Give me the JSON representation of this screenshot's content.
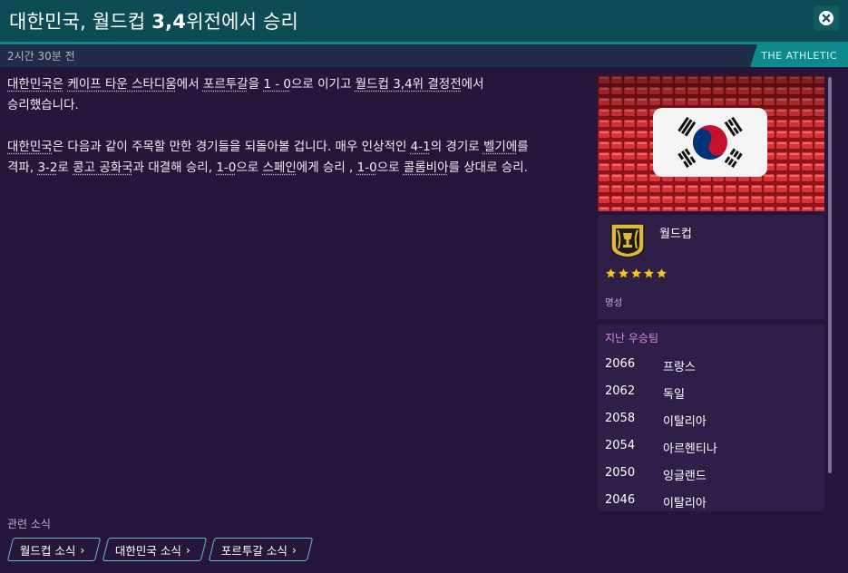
{
  "header": {
    "title_prefix": "대한민국, 월드컵 ",
    "title_bold": "3,4",
    "title_suffix": "위전에서 승리",
    "close_icon": "close-circle-icon"
  },
  "meta": {
    "time_ago": "2시간 30분 전",
    "source": "THE ATHLETIC"
  },
  "article": {
    "p1": {
      "t1": "대한민국은",
      "t2": " ",
      "t3": "케이프 타운 스타디움",
      "t4": "에서 ",
      "t5": "포르투갈",
      "t6": "을 ",
      "t7": "1 - 0",
      "t8": "으로 이기고 ",
      "t9": "월드컵 3,4위 결정전",
      "t10": "에서",
      "t11": "승리했습니다."
    },
    "p2": {
      "t1": "대한민국",
      "t2": "은 다음과 같이 주목할 만한 경기들을 되돌아볼 겁니다. 매우 인상적인 ",
      "t3": "4-1",
      "t4": "의 경기로 ",
      "t5": "벨기에",
      "t6": "를",
      "t7": "격파, ",
      "t8": "3-2",
      "t9": "로 ",
      "t10": "콩고 공화국",
      "t11": "과 대결해 승리, ",
      "t12": "1-0",
      "t13": "으로 ",
      "t14": "스페인",
      "t15": "에게 승리 , ",
      "t16": "1-0",
      "t17": "으로 ",
      "t18": "콜롬비아",
      "t19": "를 상대로 승리."
    }
  },
  "related": {
    "label": "관련 소식",
    "chips": [
      "월드컵 소식",
      "대한민국 소식",
      "포르투갈 소식"
    ]
  },
  "competition": {
    "name": "월드컵",
    "stars": 5,
    "reputation_label": "명성",
    "icon": "world-cup-trophy-icon",
    "star_color": "#f5c518"
  },
  "past_winners": {
    "label": "지난 우승팀",
    "rows": [
      {
        "year": "2066",
        "country": "프랑스"
      },
      {
        "year": "2062",
        "country": "독일"
      },
      {
        "year": "2058",
        "country": "이탈리아"
      },
      {
        "year": "2054",
        "country": "아르헨티나"
      },
      {
        "year": "2050",
        "country": "잉글랜드"
      },
      {
        "year": "2046",
        "country": "이탈리아"
      }
    ]
  },
  "colors": {
    "background": "#26163a",
    "titlebar": "#0d4b55",
    "accent_teal": "#0e8a8e",
    "panel": "#2e1f48",
    "winners_label": "#d48ce0"
  }
}
